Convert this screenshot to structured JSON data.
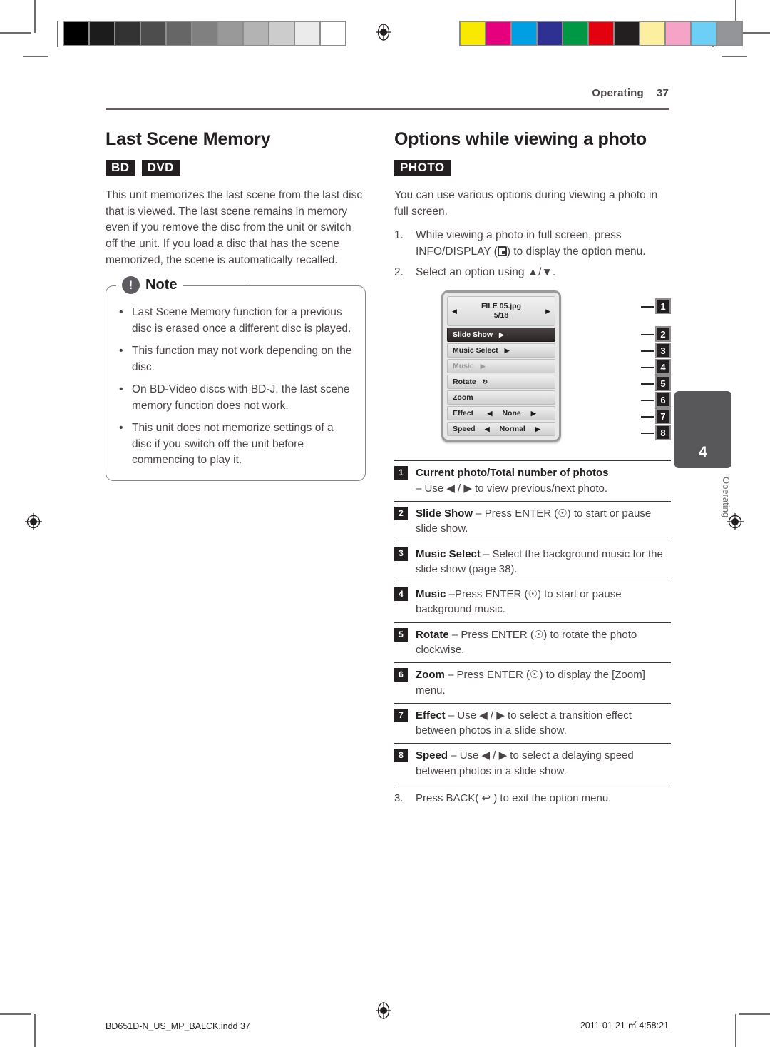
{
  "header": {
    "section": "Operating",
    "page": "37"
  },
  "left": {
    "title": "Last Scene Memory",
    "badges": [
      "BD",
      "DVD"
    ],
    "body": "This unit memorizes the last scene from the last disc that is viewed. The last scene remains in memory even if you remove the disc from the unit or switch off the unit. If you load a disc that has the scene memorized, the scene is automatically recalled.",
    "note": {
      "icon": "!",
      "label": "Note",
      "items": [
        "Last Scene Memory function for a previous disc is erased once a different disc is played.",
        "This function may not work depending on the disc.",
        "On BD-Video discs with BD-J, the last scene memory function does not work.",
        "This unit does not memorize settings of a disc if you switch off the unit before commencing to play it."
      ]
    }
  },
  "right": {
    "title": "Options while viewing a photo",
    "badges": [
      "PHOTO"
    ],
    "intro": "You can use various options during viewing a photo in full screen.",
    "steps": [
      {
        "num": "1.",
        "pre": "While viewing a photo in full screen, press INFO/DISPLAY (",
        "post": ") to display the option menu."
      },
      {
        "num": "2.",
        "text": "Select an option using ▲/▼."
      }
    ],
    "osd": {
      "filename": "FILE 05.jpg",
      "counter": "5/18",
      "left_arrow": "◀",
      "right_arrow": "▶",
      "rows": [
        {
          "label": "Slide Show",
          "play": "▶",
          "state": "selected"
        },
        {
          "label": "Music Select",
          "play": "▶",
          "state": "normal"
        },
        {
          "label": "Music",
          "play": "▶",
          "state": "dim"
        },
        {
          "label": "Rotate",
          "play": "↻",
          "state": "normal"
        },
        {
          "label": "Zoom",
          "play": "",
          "state": "normal"
        },
        {
          "label": "Effect",
          "value": "None",
          "state": "normal"
        },
        {
          "label": "Speed",
          "value": "Normal",
          "state": "normal"
        }
      ],
      "callouts": [
        "1",
        "2",
        "3",
        "4",
        "5",
        "6",
        "7",
        "8"
      ]
    },
    "legend": [
      {
        "n": "1",
        "title": "Current photo/Total number of photos",
        "desc": " – Use ◀ / ▶ to view previous/next photo.",
        "title_break": true
      },
      {
        "n": "2",
        "title": "Slide Show",
        "desc": " – Press ENTER (☉) to start or pause slide show."
      },
      {
        "n": "3",
        "title": "Music Select",
        "desc": " – Select the background music for the slide show (page 38)."
      },
      {
        "n": "4",
        "title": "Music",
        "desc": " –Press ENTER (☉) to start or pause background music."
      },
      {
        "n": "5",
        "title": "Rotate",
        "desc": " – Press ENTER (☉) to rotate the photo clockwise."
      },
      {
        "n": "6",
        "title": "Zoom",
        "desc": " – Press ENTER (☉) to display the [Zoom] menu."
      },
      {
        "n": "7",
        "title": "Effect",
        "desc": " – Use ◀ / ▶ to select a transition effect between photos in a slide show."
      },
      {
        "n": "8",
        "title": "Speed",
        "desc": " – Use ◀ / ▶ to select a delaying speed between photos in a slide show."
      }
    ],
    "closing": {
      "num": "3.",
      "text": "Press BACK( ↩ ) to exit the option menu."
    }
  },
  "side_tab": {
    "number": "4",
    "label": "Operating"
  },
  "footer": {
    "left": "BD651D-N_US_MP_BALCK.indd   37",
    "right": "2011-01-21   ㎡ 4:58:21"
  },
  "calibration": {
    "gray": [
      "#000000",
      "#1c1c1c",
      "#333333",
      "#4d4d4d",
      "#666666",
      "#808080",
      "#999999",
      "#b3b3b3",
      "#cccccc",
      "#ebebeb",
      "#ffffff"
    ],
    "color": [
      "#f9e800",
      "#e6007e",
      "#009fe3",
      "#2e3192",
      "#009845",
      "#e3000f",
      "#231f20",
      "#fcf0a0",
      "#f5a3c7",
      "#6ecff6",
      "#939598"
    ]
  }
}
